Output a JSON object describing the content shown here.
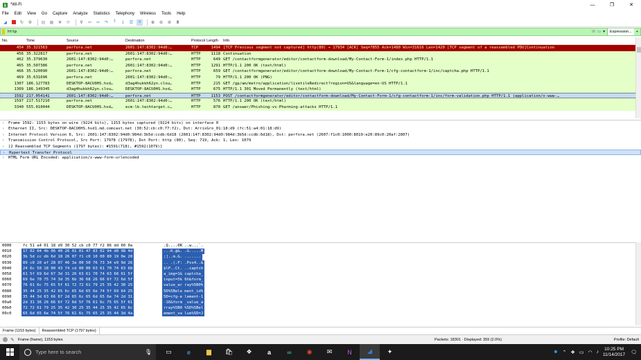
{
  "window": {
    "title": "*Wi-Fi",
    "controls": [
      "—",
      "❐",
      "✕"
    ]
  },
  "menu": [
    "File",
    "Edit",
    "View",
    "Go",
    "Capture",
    "Analyze",
    "Statistics",
    "Telephony",
    "Wireless",
    "Tools",
    "Help"
  ],
  "toolbar_icons": [
    "shark-fin-icon",
    "stop-icon",
    "restart-icon",
    "options-icon",
    "open-icon",
    "save-icon",
    "close-file-icon",
    "reload-icon",
    "find-icon",
    "back-icon",
    "forward-icon",
    "goto-icon",
    "first-icon",
    "last-icon",
    "autoscroll-icon",
    "colorize-icon",
    "zoom-in-icon",
    "zoom-out-icon",
    "zoom-reset-icon",
    "resize-columns-icon"
  ],
  "filter": {
    "value": "http",
    "expression_label": "Expression...",
    "add_label": "+"
  },
  "columns": {
    "no": "No.",
    "time": "Time",
    "source": "Source",
    "destination": "Destination",
    "protocol": "Protocol",
    "length": "Length",
    "info": "Info"
  },
  "packets": [
    {
      "no": "454",
      "time": "35.321563",
      "src": "perfora.net",
      "dst": "2601:147:8302:94d0:…",
      "proto": "TCP",
      "len": "1494",
      "info": "[TCP Previous segment not captured] http(80) → 17934 [ACK] Seq=7855 Ack=1480 Win=31616 Len=1420 [TCP segment of a reassembled PDU]Continuation",
      "style": "bad"
    },
    {
      "no": "456",
      "time": "35.322817",
      "src": "perfora.net",
      "dst": "2601:147:8302:94d0:…",
      "proto": "HTTP",
      "len": "1118",
      "info": "Continuation",
      "style": "normal"
    },
    {
      "no": "462",
      "time": "35.379630",
      "src": "2601:147:8302:94d0:…",
      "dst": "perfora.net",
      "proto": "HTTP",
      "len": "649",
      "info": "GET /contactformgenerator/editor/contactform-download/My-Contact-Form-1/index.php HTTP/1.1",
      "style": "normal"
    },
    {
      "no": "465",
      "time": "35.507386",
      "src": "perfora.net",
      "dst": "2601:147:8302:94d0:…",
      "proto": "HTTP",
      "len": "1291",
      "info": "HTTP/1.1 200 OK  (text/html)",
      "style": "normal"
    },
    {
      "no": "466",
      "time": "35.520090",
      "src": "2601:147:8302:94d0:…",
      "dst": "perfora.net",
      "proto": "HTTP",
      "len": "659",
      "info": "GET /contactformgenerator/editor/contactform-download/My-Contact-Form-1/cfg-contactform-1/inc/captcha.php HTTP/1.1",
      "style": "normal"
    },
    {
      "no": "469",
      "time": "35.631696",
      "src": "perfora.net",
      "dst": "2601:147:8302:94d0:…",
      "proto": "HTTP",
      "len": "79",
      "info": "HTTP/1.1 200 OK  (PNG)",
      "style": "normal"
    },
    {
      "no": "1307",
      "time": "186.127783",
      "src": "DESKTOP-8ACU0HS.hsd…",
      "dst": "d3ag4hukkh62yn.clou…",
      "proto": "HTTP",
      "len": "215",
      "info": "GET /gp/am/metro/application/livetileRedirect?region=US&language=en-US HTTP/1.1",
      "style": "normal"
    },
    {
      "no": "1309",
      "time": "186.149345",
      "src": "d3ag4hukkh62yn.clou…",
      "dst": "DESKTOP-8ACU0HS.hsd…",
      "proto": "HTTP",
      "len": "675",
      "info": "HTTP/1.1 301 Moved Permanently  (text/html)",
      "style": "normal"
    },
    {
      "no": "1592",
      "time": "217.054141",
      "src": "2601:147:8302:94d0:…",
      "dst": "perfora.net",
      "proto": "HTTP",
      "len": "1153",
      "info": "POST /contactformgenerator/editor/contactform-download/My-Contact-Form-1/cfg-contactform-1/inc/form-validation.php HTTP/1.1  (application/x-www-…",
      "style": "sel"
    },
    {
      "no": "1597",
      "time": "217.517210",
      "src": "perfora.net",
      "dst": "2601:147:8302:94d0:…",
      "proto": "HTTP",
      "len": "576",
      "info": "HTTP/1.1 200 OK  (text/html)",
      "style": "normal"
    },
    {
      "no": "3340",
      "time": "555.010044",
      "src": "DESKTOP-8ACU0HS.hsd…",
      "dst": "ecm-lb.techtarget.c…",
      "proto": "HTTP",
      "len": "870",
      "info": "GET /answer/Phishing-vs-Pharming-attacks HTTP/1.1",
      "style": "normal"
    }
  ],
  "details": [
    {
      "text": "Frame 1592: 1153 bytes on wire (9224 bits), 1153 bytes captured (9224 bits) on interface 0",
      "sel": false
    },
    {
      "text": "Ethernet II, Src: DESKTOP-8ACU0HS.hsd1.md.comcast.net (30:52:cb:c0:77:f2), Dst: ArrisGro_01:18:d9 (fc:51:a4:01:18:d9)",
      "sel": false
    },
    {
      "text": "Internet Protocol Version 6, Src: 2601:147:8302:94d0:984d:3b5d:ccdb:6d18 (2601:147:8302:94d0:984d:3b5d:ccdb:6d18), Dst: perfora.net (2607:f1c0:1000:8019:e20:89c0:20af:2807)",
      "sel": false
    },
    {
      "text": "Transmission Control Protocol, Src Port: 17978 (17978), Dst Port: http (80), Seq: 719, Ack: 1, Len: 1079",
      "sel": false
    },
    {
      "text": "[2 Reassembled TCP Segments (1797 bytes): #1591(718), #1592(1079)]",
      "sel": false
    },
    {
      "text": "Hypertext Transfer Protocol",
      "sel": true
    },
    {
      "text": "HTML Form URL Encoded: application/x-www-form-urlencoded",
      "sel": false
    }
  ],
  "bytes": [
    {
      "off": "0000",
      "hex": "fc 51 a4 01 18 d9 30 52  cb c0 77 f2 86 dd 60 0a",
      "asc": ".Q....0R ..w...`.",
      "hl": false
    },
    {
      "off": "0010",
      "hex": "17 02 04 4b 06 40 26 01  01 47 83 02 94 d0 98 4d",
      "asc": "...K.@&. .G.....M",
      "hl": false
    },
    {
      "off": "0020",
      "hex": "3b 5d cc db 6d 18 26 07  f1 c0 10 00 80 19 0e 20",
      "asc": ";]..m.&. .......",
      "hl": false
    },
    {
      "off": "0030",
      "hex": "89 c0 20 af 28 07 46 3a  00 50 76 73 34 e9 9d 26",
      "asc": ".. .(.F: .Pvs4..&",
      "hl": false
    },
    {
      "off": "0040",
      "hex": "24 6c 50 18 00 43 74 cd  00 00 63 61 70 74 63 68",
      "asc": "$lP..Ct. ..captch",
      "hl": false
    },
    {
      "off": "0050",
      "hex": "61 5f 69 6d 67 3d 31 26  63 61 70 74 63 68 61 5f",
      "asc": "a_img=1& captcha_",
      "hl": false
    },
    {
      "off": "0060",
      "hex": "69 6e 70 75 74 3d 35 6b  36 68 26 66 6f 72 6d 5f",
      "asc": "input=5k 6h&form_",
      "hl": false
    },
    {
      "off": "0070",
      "hex": "76 61 6c 75 65 5f 61 72  72 61 79 25 35 42 30 25",
      "asc": "value_ar ray%5B0%",
      "hl": false
    },
    {
      "off": "0080",
      "hex": "35 44 25 35 42 65 6c 65  6d 65 6e 74 5f 69 64 25",
      "asc": "5D%5Bele ment_id%",
      "hl": false
    },
    {
      "off": "0090",
      "hex": "35 44 3d 63 66 67 2d 65  6c 65 6d 65 6e 74 2d 31",
      "asc": "5D=cfg-e lement-1",
      "hl": false
    },
    {
      "off": "00a0",
      "hex": "2d 31 36 26 66 6f 72 6d  5f 76 61 6c 75 65 5f 61",
      "asc": "-16&form _value_a",
      "hl": false
    },
    {
      "off": "00b0",
      "hex": "72 72 61 79 25 35 42 30  25 35 44 25 35 42 65 6c",
      "asc": "rray%5B0 %5D%5Bel",
      "hl": false
    },
    {
      "off": "00c0",
      "hex": "65 6d 65 6e 74 5f 76 61  6c 75 65 25 35 44 3d 4a",
      "asc": "ement_va lue%5D=J",
      "hl": false
    }
  ],
  "bytes_tabs": [
    "Frame (1153 bytes)",
    "Reassembled TCP (1797 bytes)"
  ],
  "status": {
    "left": "Frame (frame), 1153 bytes",
    "packets": "Packets: 18301 · Displayed: 359 (2.0%)",
    "profile": "Profile: Default"
  },
  "taskbar": {
    "search_placeholder": "Type here to search",
    "time": "10:25 PM",
    "date": "11/14/2017",
    "apps": [
      "task-view-icon",
      "edge-icon",
      "file-explorer-icon",
      "store-icon",
      "dropbox-icon",
      "amazon-icon",
      "tripadvisor-icon",
      "chrome-icon",
      "mail-icon",
      "onenote-icon",
      "wireshark-icon",
      "extra-app-icon"
    ]
  },
  "colors": {
    "http_row": "#e4ffc7",
    "bad_row": "#a40000",
    "bad_text": "#fff3b3",
    "selected_row": "#c4dcf1",
    "filter_ok": "#b9f5b3",
    "bytes_highlight": "#2d5fb0",
    "taskbar": "#1b1b1b"
  }
}
